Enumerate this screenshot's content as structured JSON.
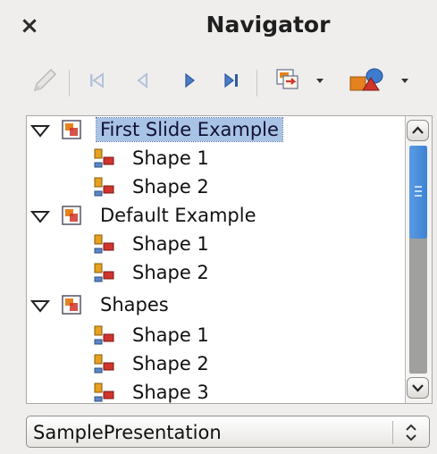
{
  "window": {
    "title": "Navigator",
    "close_glyph": "×"
  },
  "toolbar": {
    "buttons": [
      {
        "name": "draw-mode-icon",
        "enabled": false
      },
      {
        "name": "first-slide-icon",
        "enabled": false
      },
      {
        "name": "previous-slide-icon",
        "enabled": false
      },
      {
        "name": "next-slide-icon",
        "enabled": true
      },
      {
        "name": "last-slide-icon",
        "enabled": true
      },
      {
        "name": "drag-mode-icon",
        "enabled": true
      },
      {
        "name": "show-shapes-icon",
        "enabled": true
      }
    ]
  },
  "tree": {
    "selected": "First Slide Example",
    "slides": [
      {
        "label": "First Slide Example",
        "expanded": true,
        "shapes": [
          "Shape 1",
          "Shape 2"
        ]
      },
      {
        "label": "Default Example",
        "expanded": true,
        "shapes": [
          "Shape 1",
          "Shape 2"
        ]
      },
      {
        "label": "Shapes",
        "expanded": true,
        "shapes": [
          "Shape 1",
          "Shape 2",
          "Shape 3"
        ]
      }
    ]
  },
  "document_select": {
    "value": "SamplePresentation"
  },
  "colors": {
    "selection": "#a9c3e6",
    "scroll_thumb": "#4a8fdc",
    "icon_orange": "#e5821f",
    "icon_red": "#d0342c"
  }
}
